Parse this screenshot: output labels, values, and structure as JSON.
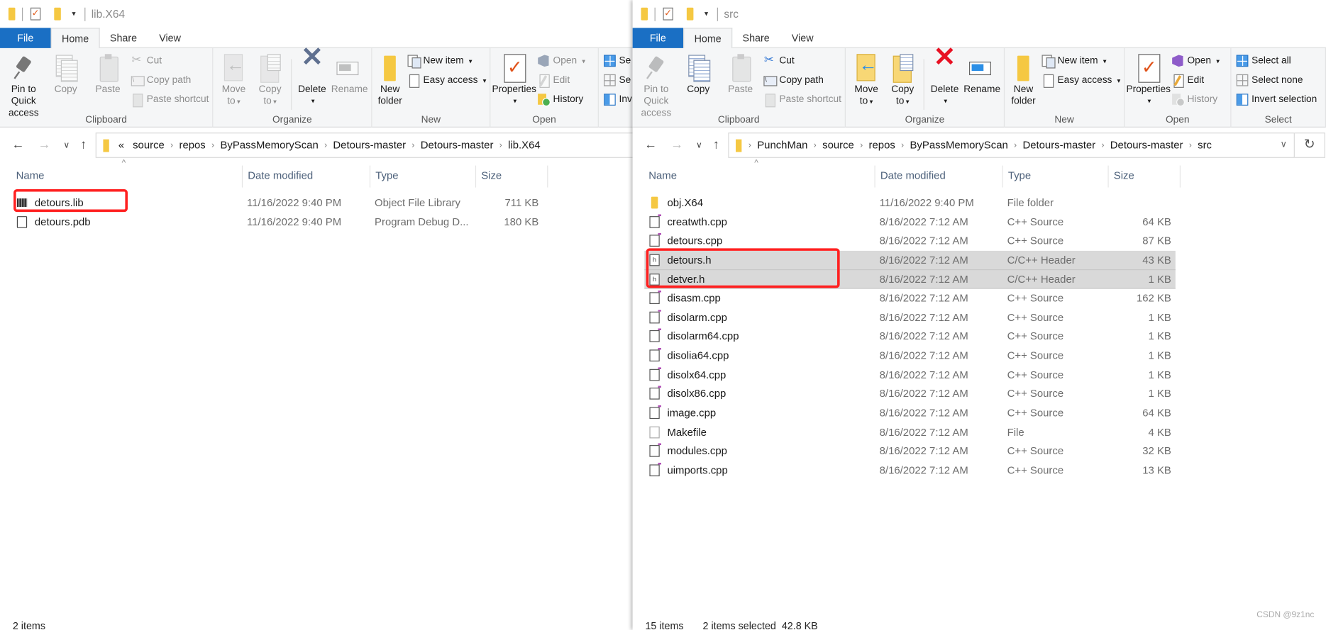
{
  "colors": {
    "file_tab": "#1a6fc4",
    "highlight_box": "#ff2020",
    "selection": "#d9d9d9"
  },
  "windows": [
    {
      "id": "left",
      "title": "lib.X64",
      "tabs": [
        "File",
        "Home",
        "Share",
        "View"
      ],
      "ribbon": [
        {
          "label": "Clipboard",
          "width": 252,
          "items": [
            {
              "kind": "large",
              "label": "Pin to Quick",
              "label2": "access",
              "icon": "pin",
              "disabled": false
            },
            {
              "kind": "large",
              "label": "Copy",
              "icon": "copy",
              "disabled": true
            },
            {
              "kind": "large",
              "label": "Paste",
              "icon": "paste",
              "disabled": true
            },
            {
              "kind": "col",
              "items": [
                {
                  "label": "Cut",
                  "icon": "cut",
                  "disabled": true
                },
                {
                  "label": "Copy path",
                  "icon": "copypath",
                  "disabled": true
                },
                {
                  "label": "Paste shortcut",
                  "icon": "pasteshort",
                  "disabled": true
                }
              ]
            }
          ]
        },
        {
          "label": "Organize",
          "width": 188,
          "items": [
            {
              "kind": "large",
              "label": "Move",
              "label2": "to",
              "dropdown": true,
              "icon": "move",
              "disabled": true
            },
            {
              "kind": "large",
              "label": "Copy",
              "label2": "to",
              "dropdown": true,
              "icon": "copyto",
              "disabled": true
            },
            {
              "kind": "sep"
            },
            {
              "kind": "large",
              "label": "Delete",
              "dropdown": true,
              "icon": "delete",
              "icon_color": "#5f7090",
              "disabled": false
            },
            {
              "kind": "large",
              "label": "Rename",
              "icon": "rename",
              "disabled": true
            }
          ]
        },
        {
          "label": "New",
          "width": 140,
          "items": [
            {
              "kind": "large",
              "label": "New",
              "label2": "folder",
              "icon": "newfolder",
              "disabled": false
            },
            {
              "kind": "col",
              "items": [
                {
                  "label": "New item",
                  "icon": "newitem",
                  "dropdown": true,
                  "disabled": false
                },
                {
                  "label": "Easy access",
                  "icon": "easy",
                  "dropdown": true,
                  "disabled": false
                }
              ]
            }
          ]
        },
        {
          "label": "Open",
          "width": 128,
          "items": [
            {
              "kind": "large",
              "label": "Properties",
              "dropdown": true,
              "icon": "props",
              "disabled": false
            },
            {
              "kind": "col",
              "items": [
                {
                  "label": "Open",
                  "icon": "open",
                  "dropdown": true,
                  "disabled": true
                },
                {
                  "label": "Edit",
                  "icon": "edit",
                  "disabled": true
                },
                {
                  "label": "History",
                  "icon": "history",
                  "disabled": false
                }
              ]
            }
          ]
        },
        {
          "label": "",
          "width": 120,
          "items": [
            {
              "kind": "col",
              "items": [
                {
                  "label": "Se",
                  "icon": "selall",
                  "disabled": false
                },
                {
                  "label": "Se",
                  "icon": "selnone",
                  "disabled": false
                },
                {
                  "label": "Inv",
                  "icon": "invsel",
                  "disabled": false
                }
              ]
            }
          ]
        }
      ],
      "address": {
        "prefix": "«",
        "crumbs": [
          "source",
          "repos",
          "ByPassMemoryScan",
          "Detours-master",
          "Detours-master",
          "lib.X64"
        ],
        "has_leading_chevron": false
      },
      "columns": [
        "Name",
        "Date modified",
        "Type",
        "Size"
      ],
      "rows": [
        {
          "name": "detours.lib",
          "date": "11/16/2022 9:40 PM",
          "type": "Object File Library",
          "size": "711 KB",
          "icon": "lib",
          "selected": false
        },
        {
          "name": "detours.pdb",
          "date": "11/16/2022 9:40 PM",
          "type": "Program Debug D...",
          "size": "180 KB",
          "icon": "pdb",
          "selected": false
        }
      ],
      "status": {
        "count": "2 items",
        "selection": ""
      }
    },
    {
      "id": "right",
      "title": "src",
      "tabs": [
        "File",
        "Home",
        "Share",
        "View"
      ],
      "ribbon": [
        {
          "label": "Clipboard",
          "width": 252,
          "items": [
            {
              "kind": "large",
              "label": "Pin to Quick",
              "label2": "access",
              "icon": "pin",
              "disabled": true
            },
            {
              "kind": "large",
              "label": "Copy",
              "icon": "copy",
              "disabled": false
            },
            {
              "kind": "large",
              "label": "Paste",
              "icon": "paste",
              "disabled": true
            },
            {
              "kind": "col",
              "items": [
                {
                  "label": "Cut",
                  "icon": "cut",
                  "disabled": false
                },
                {
                  "label": "Copy path",
                  "icon": "copypath",
                  "disabled": false
                },
                {
                  "label": "Paste shortcut",
                  "icon": "pasteshort",
                  "disabled": true
                }
              ]
            }
          ]
        },
        {
          "label": "Organize",
          "width": 188,
          "items": [
            {
              "kind": "large",
              "label": "Move",
              "label2": "to",
              "dropdown": true,
              "icon": "move",
              "disabled": false
            },
            {
              "kind": "large",
              "label": "Copy",
              "label2": "to",
              "dropdown": true,
              "icon": "copyto",
              "disabled": false
            },
            {
              "kind": "sep"
            },
            {
              "kind": "large",
              "label": "Delete",
              "dropdown": true,
              "icon": "delete",
              "icon_color": "#e81123",
              "disabled": false
            },
            {
              "kind": "large",
              "label": "Rename",
              "icon": "rename",
              "disabled": false
            }
          ]
        },
        {
          "label": "New",
          "width": 142,
          "items": [
            {
              "kind": "large",
              "label": "New",
              "label2": "folder",
              "icon": "newfolder",
              "disabled": false
            },
            {
              "kind": "col",
              "items": [
                {
                  "label": "New item",
                  "icon": "newitem",
                  "dropdown": true,
                  "disabled": false
                },
                {
                  "label": "Easy access",
                  "icon": "easy",
                  "dropdown": true,
                  "disabled": false
                }
              ]
            }
          ]
        },
        {
          "label": "Open",
          "width": 126,
          "items": [
            {
              "kind": "large",
              "label": "Properties",
              "dropdown": true,
              "icon": "props",
              "disabled": false
            },
            {
              "kind": "col",
              "items": [
                {
                  "label": "Open",
                  "icon": "open",
                  "dropdown": true,
                  "disabled": false
                },
                {
                  "label": "Edit",
                  "icon": "edit",
                  "disabled": false
                },
                {
                  "label": "History",
                  "icon": "history",
                  "disabled": true
                }
              ]
            }
          ]
        },
        {
          "label": "Select",
          "width": 112,
          "items": [
            {
              "kind": "col",
              "items": [
                {
                  "label": "Select all",
                  "icon": "selall",
                  "disabled": false
                },
                {
                  "label": "Select none",
                  "icon": "selnone",
                  "disabled": false
                },
                {
                  "label": "Invert selection",
                  "icon": "invsel",
                  "disabled": false
                }
              ]
            }
          ]
        }
      ],
      "address": {
        "prefix": "",
        "crumbs": [
          "PunchMan",
          "source",
          "repos",
          "ByPassMemoryScan",
          "Detours-master",
          "Detours-master",
          "src"
        ],
        "has_leading_chevron": true
      },
      "columns": [
        "Name",
        "Date modified",
        "Type",
        "Size"
      ],
      "rows": [
        {
          "name": "obj.X64",
          "date": "11/16/2022 9:40 PM",
          "type": "File folder",
          "size": "",
          "icon": "folder",
          "selected": false
        },
        {
          "name": "creatwth.cpp",
          "date": "8/16/2022 7:12 AM",
          "type": "C++ Source",
          "size": "64 KB",
          "icon": "doc",
          "selected": false
        },
        {
          "name": "detours.cpp",
          "date": "8/16/2022 7:12 AM",
          "type": "C++ Source",
          "size": "87 KB",
          "icon": "doc",
          "selected": false
        },
        {
          "name": "detours.h",
          "date": "8/16/2022 7:12 AM",
          "type": "C/C++ Header",
          "size": "43 KB",
          "icon": "h",
          "selected": true
        },
        {
          "name": "detver.h",
          "date": "8/16/2022 7:12 AM",
          "type": "C/C++ Header",
          "size": "1 KB",
          "icon": "h",
          "selected": true
        },
        {
          "name": "disasm.cpp",
          "date": "8/16/2022 7:12 AM",
          "type": "C++ Source",
          "size": "162 KB",
          "icon": "doc",
          "selected": false
        },
        {
          "name": "disolarm.cpp",
          "date": "8/16/2022 7:12 AM",
          "type": "C++ Source",
          "size": "1 KB",
          "icon": "doc",
          "selected": false
        },
        {
          "name": "disolarm64.cpp",
          "date": "8/16/2022 7:12 AM",
          "type": "C++ Source",
          "size": "1 KB",
          "icon": "doc",
          "selected": false
        },
        {
          "name": "disolia64.cpp",
          "date": "8/16/2022 7:12 AM",
          "type": "C++ Source",
          "size": "1 KB",
          "icon": "doc",
          "selected": false
        },
        {
          "name": "disolx64.cpp",
          "date": "8/16/2022 7:12 AM",
          "type": "C++ Source",
          "size": "1 KB",
          "icon": "doc",
          "selected": false
        },
        {
          "name": "disolx86.cpp",
          "date": "8/16/2022 7:12 AM",
          "type": "C++ Source",
          "size": "1 KB",
          "icon": "doc",
          "selected": false
        },
        {
          "name": "image.cpp",
          "date": "8/16/2022 7:12 AM",
          "type": "C++ Source",
          "size": "64 KB",
          "icon": "doc",
          "selected": false
        },
        {
          "name": "Makefile",
          "date": "8/16/2022 7:12 AM",
          "type": "File",
          "size": "4 KB",
          "icon": "plain",
          "selected": false
        },
        {
          "name": "modules.cpp",
          "date": "8/16/2022 7:12 AM",
          "type": "C++ Source",
          "size": "32 KB",
          "icon": "doc",
          "selected": false
        },
        {
          "name": "uimports.cpp",
          "date": "8/16/2022 7:12 AM",
          "type": "C++ Source",
          "size": "13 KB",
          "icon": "doc",
          "selected": false
        }
      ],
      "status": {
        "count": "15 items",
        "selection": "2 items selected  42.8 KB"
      }
    }
  ],
  "watermark": "CSDN @9z1nc"
}
